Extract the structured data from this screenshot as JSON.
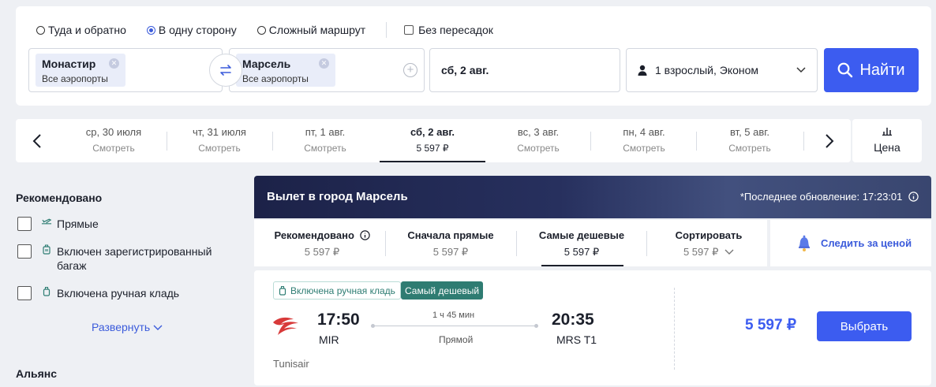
{
  "search": {
    "options": [
      {
        "label": "Туда и обратно",
        "selected": false
      },
      {
        "label": "В одну сторону",
        "selected": true
      },
      {
        "label": "Сложный маршрут",
        "selected": false
      }
    ],
    "nonstop_label": "Без пересадок",
    "from": {
      "city": "Монастир",
      "airports": "Все аэропорты"
    },
    "to": {
      "city": "Марсель",
      "airports": "Все аэропорты"
    },
    "date": "сб, 2 авг.",
    "passengers": "1 взрослый, Эконом",
    "find_label": "Найти"
  },
  "dates": [
    {
      "day": "ср, 30 июля",
      "sub": "Смотреть"
    },
    {
      "day": "чт, 31 июля",
      "sub": "Смотреть"
    },
    {
      "day": "пт, 1 авг.",
      "sub": "Смотреть"
    },
    {
      "day": "сб, 2 авг.",
      "sub": "5 597 ₽",
      "selected": true
    },
    {
      "day": "вс, 3 авг.",
      "sub": "Смотреть"
    },
    {
      "day": "пн, 4 авг.",
      "sub": "Смотреть"
    },
    {
      "day": "вт, 5 авг.",
      "sub": "Смотреть"
    }
  ],
  "price_toggle_label": "Цена",
  "filters": {
    "recommended_title": "Рекомендовано",
    "items": [
      {
        "label": "Прямые"
      },
      {
        "label": "Включен зарегистрированный багаж"
      },
      {
        "label": "Включена ручная кладь"
      }
    ],
    "expand_label": "Развернуть",
    "alliance_title": "Альянс"
  },
  "results": {
    "title": "Вылет в город Марсель",
    "updated": "*Последнее обновление: 17:23:01",
    "sort": [
      {
        "title": "Рекомендовано",
        "price": "5 597 ₽"
      },
      {
        "title": "Сначала прямые",
        "price": "5 597 ₽"
      },
      {
        "title": "Самые дешевые",
        "price": "5 597 ₽",
        "selected": true
      },
      {
        "title": "Сортировать",
        "price": "5 597 ₽"
      }
    ],
    "watch_label": "Следить за ценой"
  },
  "flight": {
    "badge_hand": "Включена ручная кладь",
    "badge_cheap": "Самый дешевый",
    "dep_time": "17:50",
    "dep_code": "MIR",
    "duration": "1 ч 45 мин",
    "stops": "Прямой",
    "arr_time": "20:35",
    "arr_code": "MRS T1",
    "airline": "Tunisair",
    "price": "5 597 ₽",
    "select_label": "Выбрать"
  },
  "colors": {
    "accent": "#3c5cf0",
    "badge_green": "#2f7c72",
    "header_dark": "#1c2248"
  }
}
